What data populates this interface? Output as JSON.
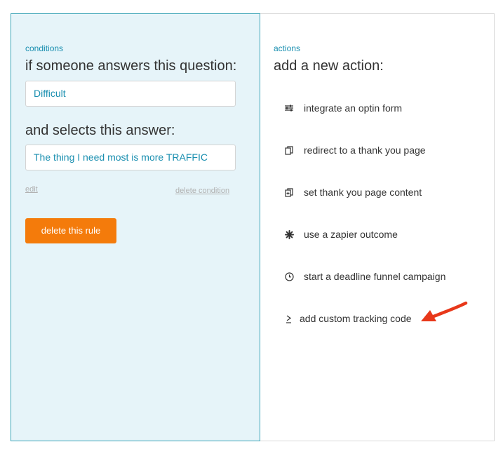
{
  "conditions": {
    "label": "conditions",
    "question_heading": "if someone answers this question:",
    "question_value": "Difficult",
    "answer_heading": "and selects this answer:",
    "answer_value": "The thing I need most is more TRAFFIC",
    "edit_link": "edit",
    "delete_condition_link": "delete condition",
    "delete_rule_button": "delete this rule"
  },
  "actions": {
    "label": "actions",
    "heading": "add a new action:",
    "items": [
      {
        "label": "integrate an optin form",
        "icon": "sliders-icon"
      },
      {
        "label": "redirect to a thank you page",
        "icon": "copy-icon"
      },
      {
        "label": "set thank you page content",
        "icon": "add-page-icon"
      },
      {
        "label": "use a zapier outcome",
        "icon": "asterisk-icon"
      },
      {
        "label": "start a deadline funnel campaign",
        "icon": "clock-icon"
      },
      {
        "label": "add custom tracking code",
        "icon": "terminal-icon"
      }
    ]
  },
  "colors": {
    "accent_blue": "#1a8fb0",
    "button_orange": "#f47b0b",
    "panel_bg": "#e6f4f9",
    "arrow_red": "#e8381a"
  }
}
